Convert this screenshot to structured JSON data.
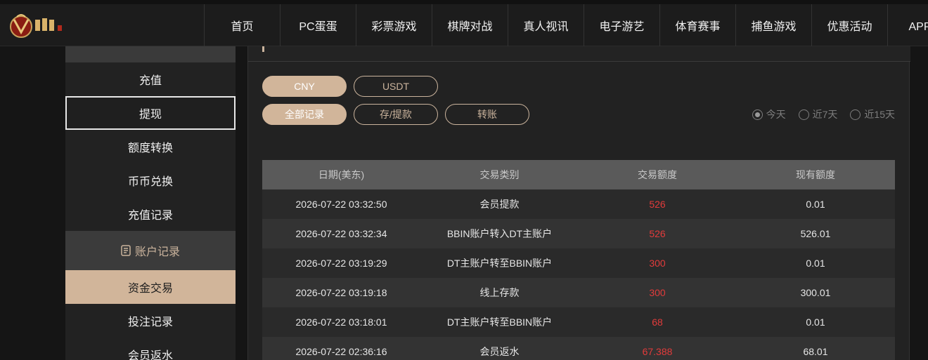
{
  "header": {
    "nav": [
      "首页",
      "PC蛋蛋",
      "彩票游戏",
      "棋牌对战",
      "真人视讯",
      "电子游艺",
      "体育赛事",
      "捕鱼游戏",
      "优惠活动",
      "APP下"
    ]
  },
  "sidebar": {
    "items_top": [
      "充值",
      "提现",
      "额度转换",
      "币币兑换",
      "充值记录"
    ],
    "section_label": "账户记录",
    "items_bottom": [
      "资金交易",
      "投注记录",
      "会员返水"
    ]
  },
  "main": {
    "currency_tabs": [
      "CNY",
      "USDT"
    ],
    "type_tabs": [
      "全部记录",
      "存/提款",
      "转账"
    ],
    "range_options": [
      "今天",
      "近7天",
      "近15天"
    ],
    "table": {
      "headers": [
        "日期(美东)",
        "交易类别",
        "交易额度",
        "现有额度"
      ],
      "rows": [
        [
          "2026-07-22 03:32:50",
          "会员提款",
          "526",
          "0.01"
        ],
        [
          "2026-07-22 03:32:34",
          "BBIN账户转入DT主账户",
          "526",
          "526.01"
        ],
        [
          "2026-07-22 03:19:29",
          "DT主账户转至BBIN账户",
          "300",
          "0.01"
        ],
        [
          "2026-07-22 03:19:18",
          "线上存款",
          "300",
          "300.01"
        ],
        [
          "2026-07-22 03:18:01",
          "DT主账户转至BBIN账户",
          "68",
          "0.01"
        ],
        [
          "2026-07-22 02:36:16",
          "会员返水",
          "67.388",
          "68.01"
        ]
      ]
    }
  },
  "colors": {
    "accent": "#d1b59a",
    "amount": "#e23b3b",
    "panel": "#222222"
  }
}
